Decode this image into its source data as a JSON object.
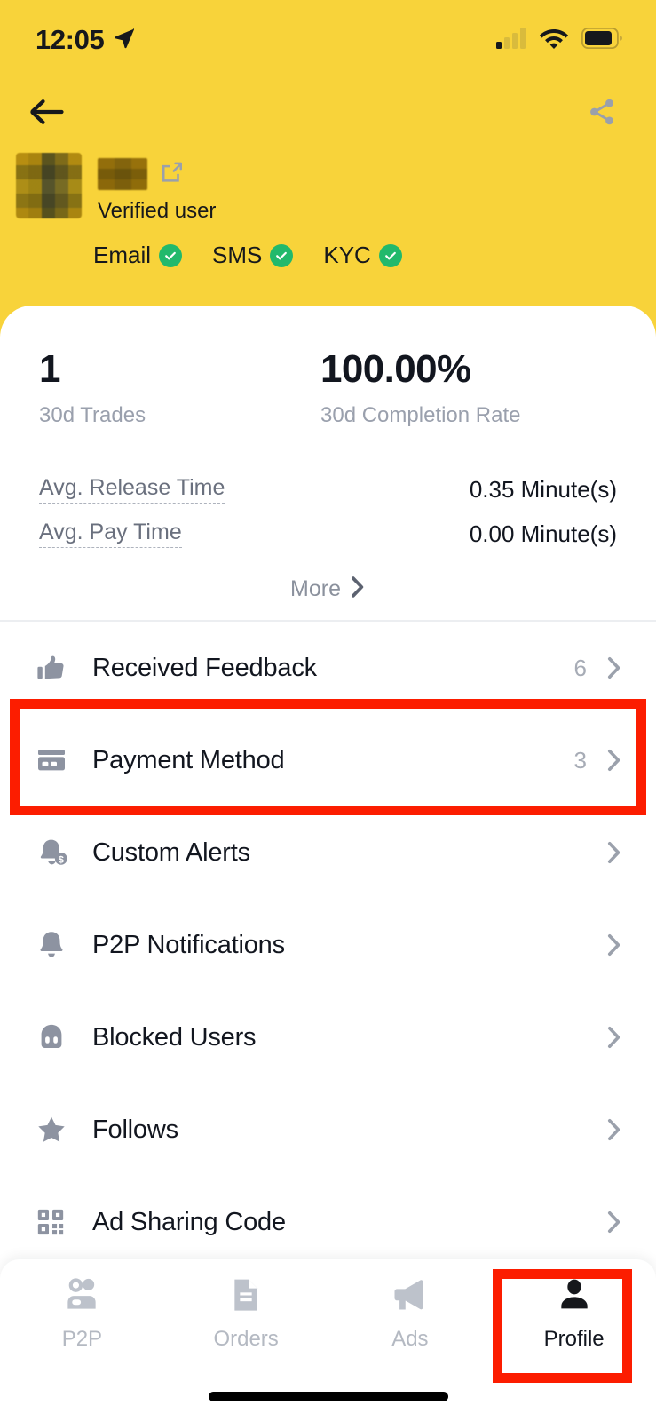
{
  "status_bar": {
    "time": "12:05",
    "location_icon": "location-arrow-icon",
    "signal_icon": "cellular-signal-icon",
    "wifi_icon": "wifi-icon",
    "battery_icon": "battery-icon"
  },
  "header": {
    "back_icon": "back-arrow-icon",
    "share_icon": "share-icon",
    "accent_color": "#f8d33a",
    "profile": {
      "avatar": "user-avatar-redacted",
      "nickname": "",
      "edit_icon": "edit-pencil-icon",
      "verified_user_label": "Verified user",
      "badges": [
        {
          "label": "Email",
          "verified": true
        },
        {
          "label": "SMS",
          "verified": true
        },
        {
          "label": "KYC",
          "verified": true
        }
      ],
      "badge_color": "#22b96c"
    }
  },
  "stats": {
    "trades": {
      "value": "1",
      "label": "30d Trades"
    },
    "completion": {
      "value": "100.00%",
      "label": "30d Completion Rate"
    },
    "rows": [
      {
        "label": "Avg. Release Time",
        "value": "0.35 Minute(s)"
      },
      {
        "label": "Avg. Pay Time",
        "value": "0.00 Minute(s)"
      }
    ],
    "more_label": "More",
    "more_chevron": "chevron-right-icon"
  },
  "menu": {
    "items": [
      {
        "label": "Received Feedback",
        "count": "6",
        "icon": "thumbs-up-icon",
        "name": "received-feedback"
      },
      {
        "label": "Payment Method",
        "count": "3",
        "icon": "credit-card-icon",
        "name": "payment-method",
        "highlighted": true
      },
      {
        "label": "Custom Alerts",
        "count": "",
        "icon": "bell-dollar-icon",
        "name": "custom-alerts"
      },
      {
        "label": "P2P Notifications",
        "count": "",
        "icon": "bell-icon",
        "name": "p2p-notifications"
      },
      {
        "label": "Blocked Users",
        "count": "",
        "icon": "blocked-user-icon",
        "name": "blocked-users"
      },
      {
        "label": "Follows",
        "count": "",
        "icon": "star-icon",
        "name": "follows"
      },
      {
        "label": "Ad Sharing Code",
        "count": "",
        "icon": "qr-code-icon",
        "name": "ad-sharing-code"
      }
    ]
  },
  "bottom_nav": {
    "items": [
      {
        "label": "P2P",
        "icon": "people-icon",
        "active": false
      },
      {
        "label": "Orders",
        "icon": "document-icon",
        "active": false
      },
      {
        "label": "Ads",
        "icon": "megaphone-icon",
        "active": false
      },
      {
        "label": "Profile",
        "icon": "person-icon",
        "active": true
      }
    ]
  },
  "highlights": {
    "color": "#fc1d00",
    "targets": [
      "payment-method-row",
      "profile-nav-tab"
    ]
  }
}
